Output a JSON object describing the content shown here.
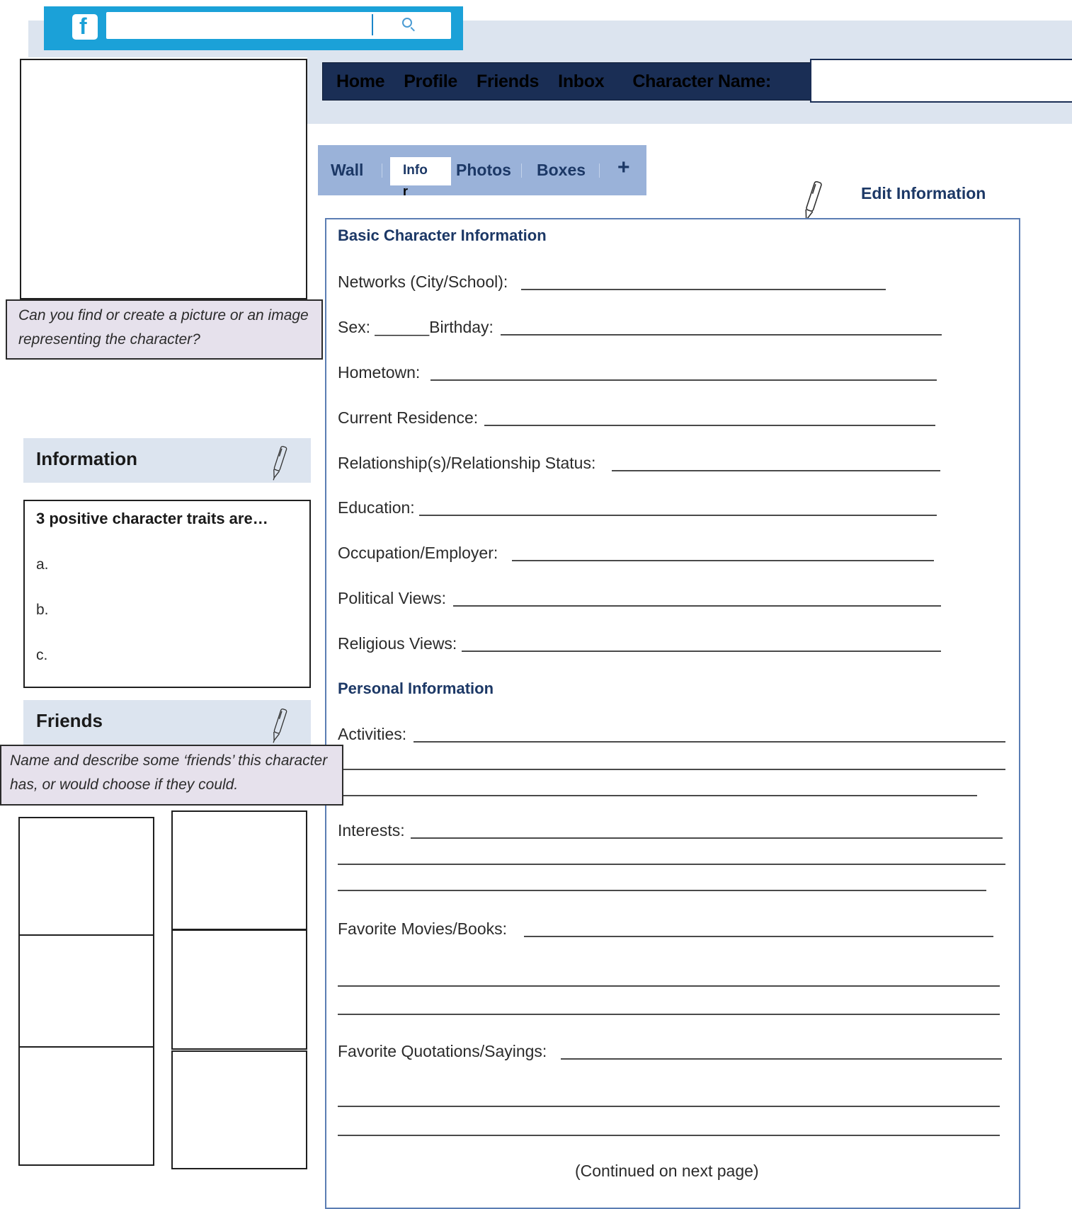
{
  "header": {
    "logo_letter": "f",
    "search_placeholder": "",
    "nav": [
      "Home",
      "Profile",
      "Friends",
      "Inbox",
      "Character Name:"
    ],
    "character_name_value": ""
  },
  "tabs": {
    "wall": "Wall",
    "info": "Info",
    "info_overflow": "r",
    "photos": "Photos",
    "boxes": "Boxes",
    "add": "+"
  },
  "edit_information": "Edit Information",
  "picture_note": "Can you find or create a picture or an image representing the character?",
  "sidebar": {
    "information_title": "Information",
    "traits_heading": "3 positive character traits are…",
    "traits": [
      "a.",
      "b.",
      "c."
    ],
    "friends_title": "Friends",
    "friends_note": "Name and describe some ‘friends’ this character has, or would choose if they could."
  },
  "form": {
    "basic_heading": "Basic Character Information",
    "networks": "Networks (City/School):",
    "sex": "Sex: ______Birthday:",
    "hometown": "Hometown:",
    "residence": "Current Residence:",
    "relationship": "Relationship(s)/Relationship Status:",
    "education": "Education:",
    "occupation": "Occupation/Employer:",
    "political": "Political Views:",
    "religious": "Religious Views:",
    "personal_heading": "Personal Information",
    "activities": "Activities:",
    "interests": "Interests:",
    "movies": "Favorite Movies/Books:",
    "quotations": "Favorite Quotations/Sayings:",
    "continued": "(Continued on next page)"
  },
  "colors": {
    "topbar": "#1ba1d8",
    "nav_bg": "#1a2e55",
    "band": "#dce4ef",
    "tabs_bg": "#9ab2d9",
    "heading": "#1c3866",
    "note_bg": "#e6e1ec",
    "form_border": "#5b7db3"
  }
}
